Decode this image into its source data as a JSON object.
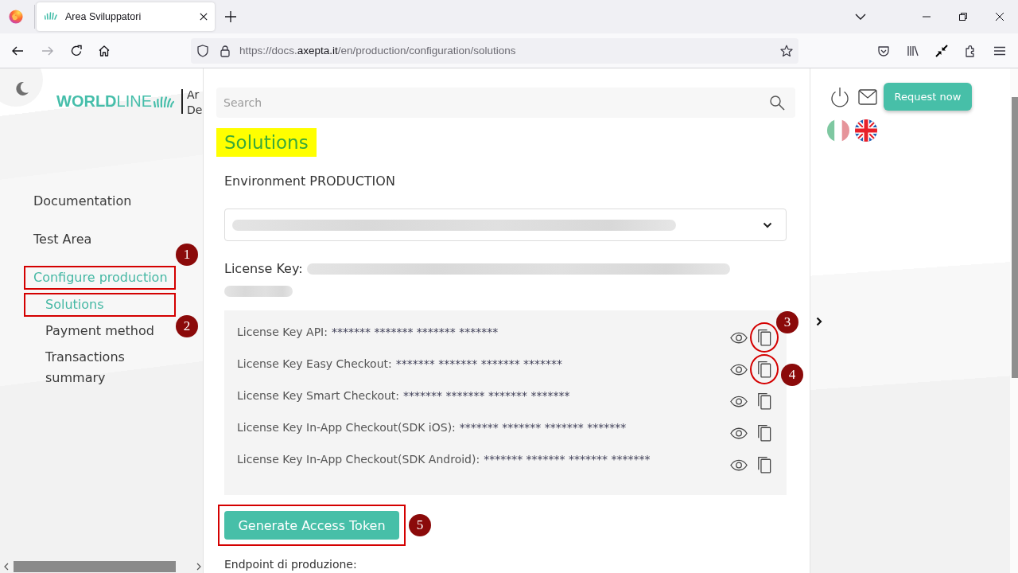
{
  "browser": {
    "tab": {
      "title": "Area Sviluppatori"
    },
    "url": "https://docs.**axepta.it**/en/production/configuration/solutions",
    "forward_disabled": true
  },
  "sidebar": {
    "logo": {
      "wordmark": "**WORLD**LINE",
      "site_name": [
        "Ar",
        "De"
      ]
    },
    "nav": [
      {
        "label": "Documentation",
        "selected": false,
        "highlighted": false
      },
      {
        "label": "Test Area",
        "selected": false,
        "highlighted": false
      },
      {
        "label": "Configure production",
        "selected": true,
        "highlighted": true,
        "marker": {
          "label": "1",
          "kind": "above"
        },
        "children": [
          {
            "label": "Solutions",
            "selected": true,
            "highlighted": true,
            "marker": {
              "label": "2",
              "kind": "below"
            }
          },
          {
            "label": "Payment method",
            "selected": false,
            "highlighted": false
          },
          {
            "label": "Transactions summary",
            "selected": false,
            "highlighted": false
          }
        ]
      }
    ]
  },
  "search": {
    "placeholder": "Search"
  },
  "title": {
    "text": "Solutions",
    "highlighted": true
  },
  "environment": "Environment PRODUCTION",
  "dropdown": {
    "redacted": true
  },
  "license_key": {
    "label": "License Key:",
    "redacted": true
  },
  "keys": [
    {
      "label": "License Key API:",
      "value": "******* ******* ******* *******",
      "copy_highlighted": true,
      "marker": {
        "label": "3",
        "kind": "above"
      }
    },
    {
      "label": "License Key Easy Checkout:",
      "value": "******* ******* ******* *******",
      "copy_highlighted": true,
      "marker": {
        "label": "4",
        "kind": "below"
      }
    },
    {
      "label": "License Key Smart Checkout:",
      "value": "******* ******* ******* *******",
      "copy_highlighted": false
    },
    {
      "label": "License Key In-App Checkout(SDK iOS):",
      "value": "******* ******* ******* *******",
      "copy_highlighted": false
    },
    {
      "label": "License Key In-App Checkout(SDK Android):",
      "value": "******* ******* ******* *******",
      "copy_highlighted": false
    }
  ],
  "generate_button": {
    "label": "Generate Access Token",
    "highlighted": true,
    "marker": {
      "label": "5",
      "kind": "right"
    }
  },
  "endpoint_label": "Endpoint di produzione:",
  "right_panel": {
    "request_button": "Request now",
    "languages": [
      {
        "kind": "italy",
        "selected": false
      },
      {
        "kind": "uk",
        "selected": true
      }
    ]
  }
}
